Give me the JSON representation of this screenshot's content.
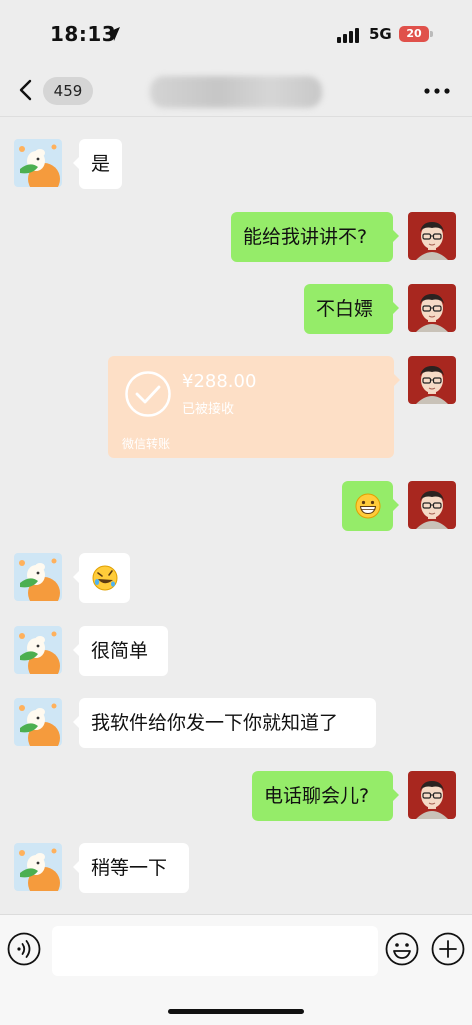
{
  "status_bar": {
    "time": "18:13",
    "network": "5G",
    "battery": "20"
  },
  "header": {
    "unread_count": "459"
  },
  "messages": [
    {
      "side": "left",
      "text": "是"
    },
    {
      "side": "right",
      "text": "能给我讲讲不?"
    },
    {
      "side": "right",
      "text": "不白嫖"
    },
    {
      "side": "right",
      "type": "transfer",
      "amount": "¥288.00",
      "status": "已被接收",
      "label": "微信转账"
    },
    {
      "side": "right",
      "type": "emoji",
      "icon": "grinning-face-emoji"
    },
    {
      "side": "left",
      "type": "emoji",
      "icon": "rolling-on-floor-laughing-emoji"
    },
    {
      "side": "left",
      "text": "很简单"
    },
    {
      "side": "left",
      "text": "我软件给你发一下你就知道了"
    },
    {
      "side": "right",
      "text": "电话聊会儿?"
    },
    {
      "side": "left",
      "text": "稍等一下"
    }
  ],
  "colors": {
    "background": "#ededed",
    "bubble_self": "#95ec69",
    "bubble_other": "#ffffff",
    "transfer_received": "#fddfc6",
    "battery_low": "#e0514b"
  }
}
